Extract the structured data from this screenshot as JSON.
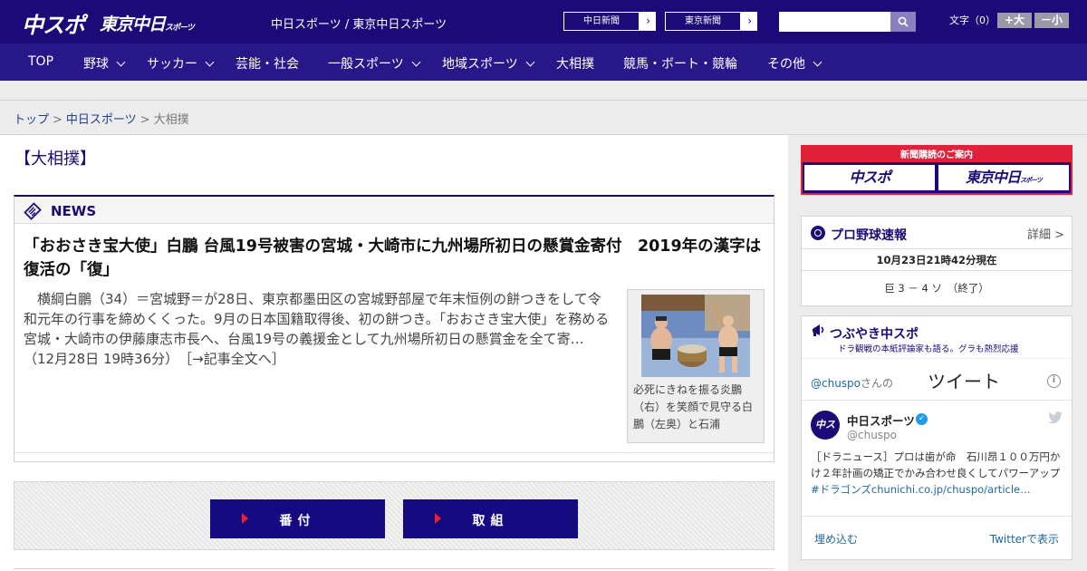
{
  "header": {
    "logo_main": "中スポ",
    "logo_tokyo": "東京中日",
    "logo_tokyo_suffix": "スポーツ",
    "site_names": "中日スポーツ / 東京中日スポーツ",
    "link_chunichi": "中日新聞",
    "link_tokyo": "東京新聞",
    "arrow": "›",
    "search_placeholder": "",
    "font_size_label": "文字（0）",
    "font_bigger": "+大",
    "font_smaller": "－小"
  },
  "nav": {
    "items": [
      "TOP",
      "野球",
      "サッカー",
      "芸能・社会",
      "一般スポーツ",
      "地域スポーツ",
      "大相撲",
      "競馬・ボート・競輪",
      "その他"
    ]
  },
  "breadcrumb": {
    "items": [
      "トップ",
      "中日スポーツ",
      "大相撲"
    ],
    "separator": ">"
  },
  "main": {
    "page_title": "【大相撲】",
    "news_label": "NEWS",
    "headline": "「おおさき宝大使」白鵬 台風19号被害の宮城・大崎市に九州場所初日の懸賞金寄付　2019年の漢字は復活の「復」",
    "body": "横綱白鵬（34）＝宮城野＝が28日、東京都墨田区の宮城野部屋で年末恒例の餅つきをして令和元年の行事を締めくくった。9月の日本国籍取得後、初の餅つき。「おおさき宝大使」を務める宮城・大崎市の伊藤康志市長へ、台風19号の義援金として九州場所初日の懸賞金を全て寄…（12月28日 19時36分）",
    "read_more": "［→記事全文へ］",
    "caption": "必死にきねを振る炎鵬（右）を笑顔で見守る白鵬（左奥）と石浦",
    "button_banzuke": "番付",
    "button_torikumi": "取組"
  },
  "sidebar": {
    "subscription_title": "新聞購読のご案内",
    "sub_logo_main": "中スポ",
    "sub_logo_tokyo": "東京中日",
    "sub_logo_tokyo_suffix": "スポーツ",
    "pro_title": "プロ野球速報",
    "pro_detail": "詳細 >",
    "pro_time": "10月23日21時42分現在",
    "pro_score": "巨 3 － 4 ソ　（終了）",
    "tw_title": "つぶやき中スポ",
    "tw_subtitle": "ドラ観戦の本紙評論家も語る。グラも熱烈応援",
    "tw_handle": "@chuspo",
    "tw_handle_suffix": "さんの",
    "tw_tweets": "ツイート",
    "tw_name": "中日スポーツ",
    "tw_at": "@chuspo",
    "tw_text": "［ドラニュース］プロは歯が命　石川昂１００万円かけ２年計画の矯正でかみ合わせ良くしてパワーアップ",
    "tw_hashtag": "#ドラゴンズ",
    "tw_link": "chunichi.co.jp/chuspo/article…",
    "tw_embed": "埋め込む",
    "tw_view": "Twitterで表示"
  },
  "colors": {
    "brand_navy": "#1b0a78",
    "nav_bg": "#271788",
    "accent_red": "#e0213a",
    "link_blue": "#1b3fa0"
  },
  "icons": {
    "search": "search-icon",
    "news": "newspaper-icon",
    "baseball": "baseball-icon",
    "megaphone": "megaphone-icon",
    "twitter": "twitter-bird-icon",
    "info": "info-icon"
  }
}
